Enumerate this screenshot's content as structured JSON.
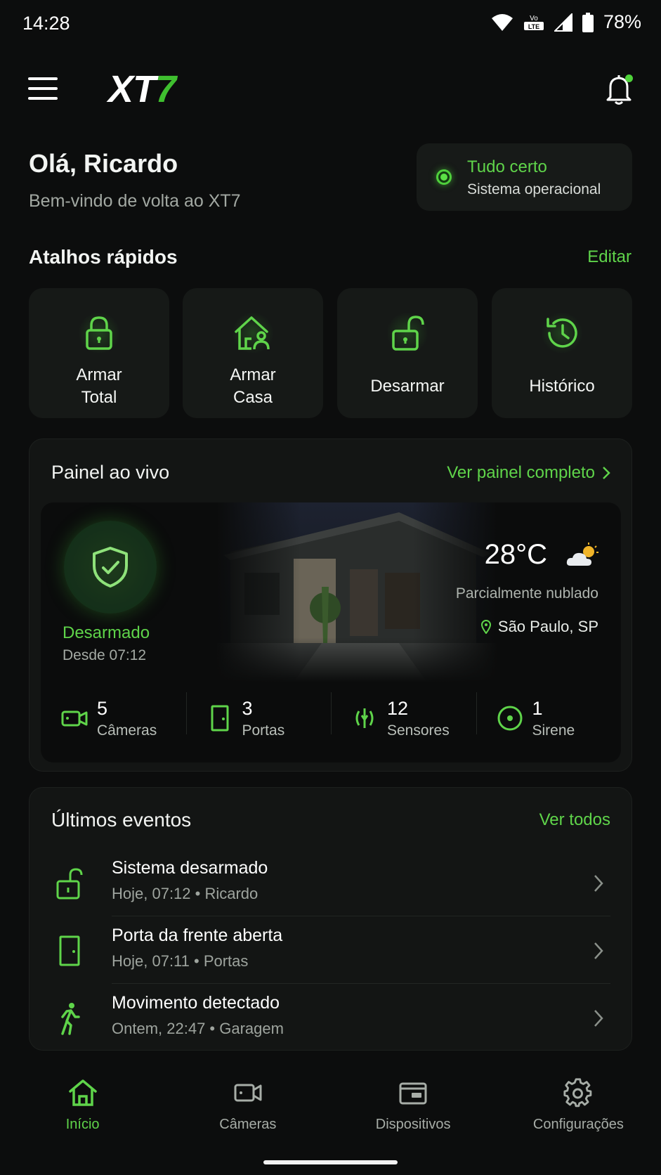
{
  "status_bar": {
    "time": "14:28",
    "volte": "Vo\nLTE",
    "battery": "78%"
  },
  "header": {
    "logo_main": "XT",
    "logo_accent": "7",
    "has_notification": true
  },
  "greeting": {
    "title": "Olá, Ricardo",
    "subtitle": "Bem-vindo de volta ao XT7"
  },
  "system_status": {
    "title": "Tudo certo",
    "subtitle": "Sistema operacional"
  },
  "shortcuts": {
    "title": "Atalhos rápidos",
    "edit_label": "Editar",
    "items": [
      {
        "label": "Armar Total",
        "icon": "lock-icon"
      },
      {
        "label": "Armar Casa",
        "icon": "home-person-icon"
      },
      {
        "label": "Desarmar",
        "icon": "unlock-icon"
      },
      {
        "label": "Histórico",
        "icon": "history-icon"
      }
    ]
  },
  "live_panel": {
    "title": "Painel ao vivo",
    "link_label": "Ver painel completo",
    "state": "Desarmado",
    "since": "Desde 07:12",
    "temperature": "28°C",
    "weather": "Parcialmente nublado",
    "location": "São Paulo, SP",
    "stats": [
      {
        "value": "5",
        "label": "Câmeras",
        "icon": "camera-icon"
      },
      {
        "value": "3",
        "label": "Portas",
        "icon": "door-icon"
      },
      {
        "value": "12",
        "label": "Sensores",
        "icon": "sensor-icon"
      },
      {
        "value": "1",
        "label": "Sirene",
        "icon": "siren-icon"
      }
    ]
  },
  "events": {
    "title": "Últimos eventos",
    "link_label": "Ver todos",
    "items": [
      {
        "title": "Sistema desarmado",
        "subtitle": "Hoje, 07:12 • Ricardo",
        "icon": "unlock-icon"
      },
      {
        "title": "Porta da frente aberta",
        "subtitle": "Hoje, 07:11 • Portas",
        "icon": "door-icon"
      },
      {
        "title": "Movimento detectado",
        "subtitle": "Ontem, 22:47 • Garagem",
        "icon": "walking-person-icon"
      }
    ]
  },
  "nav": {
    "items": [
      {
        "label": "Início",
        "icon": "home-icon",
        "active": true
      },
      {
        "label": "Câmeras",
        "icon": "camera-icon",
        "active": false
      },
      {
        "label": "Dispositivos",
        "icon": "devices-icon",
        "active": false
      },
      {
        "label": "Configurações",
        "icon": "gear-icon",
        "active": false
      }
    ]
  },
  "colors": {
    "accent": "#5fd44a",
    "background": "#0c0d0d",
    "card": "#161917"
  }
}
